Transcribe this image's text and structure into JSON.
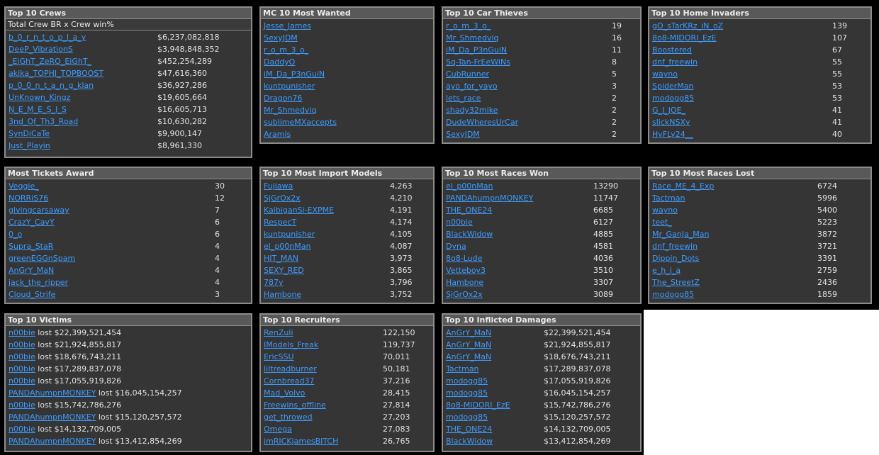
{
  "colors": {
    "background": "#000000",
    "panel_bg": "#353535",
    "panel_border": "#8c8c8c",
    "header_bg": "#595959",
    "link": "#3d9bff",
    "text": "#e2e2e2"
  },
  "top_crews": {
    "title": "Top 10 Crews",
    "subheader": "Total Crew BR x Crew win%",
    "rows": [
      {
        "name": "b_0_r_n_t_o_p_l_a_y",
        "value": "$6,237,082,818"
      },
      {
        "name": "DeeP_VibrationS",
        "value": "$3,948,848,352"
      },
      {
        "name": "_EiGhT_ZeRO_EiGhT_",
        "value": "$452,254,289"
      },
      {
        "name": "akika_TOPHI_TOPBOOST",
        "value": "$47,616,360"
      },
      {
        "name": "p_0_0_n_t_a_n_g_klan",
        "value": "$36,927,286"
      },
      {
        "name": "UnKnown_Kingz",
        "value": "$19,605,664"
      },
      {
        "name": "N_E_M_E_S_I_S",
        "value": "$16,605,713"
      },
      {
        "name": "3nd_Of_Th3_Road",
        "value": "$10,630,282"
      },
      {
        "name": "SynDiCaTe",
        "value": "$9,900,147"
      },
      {
        "name": "Just_Playin",
        "value": "$8,961,330"
      }
    ]
  },
  "mc_most_wanted": {
    "title": "MC 10 Most Wanted",
    "rows": [
      {
        "name": "Jesse_James"
      },
      {
        "name": "SexyJDM"
      },
      {
        "name": "r_o_m_3_o_"
      },
      {
        "name": "DaddyO"
      },
      {
        "name": "iM_Da_P3nGuiN"
      },
      {
        "name": "kuntpunisher"
      },
      {
        "name": "Dragon76"
      },
      {
        "name": "Mr_Shmedviq"
      },
      {
        "name": "sublimeMXaccepts"
      },
      {
        "name": "Aramis"
      }
    ]
  },
  "car_thieves": {
    "title": "Top 10 Car Thieves",
    "rows": [
      {
        "name": "r_o_m_3_o_",
        "value": "19"
      },
      {
        "name": "Mr_Shmedviq",
        "value": "16"
      },
      {
        "name": "iM_Da_P3nGuiN",
        "value": "11"
      },
      {
        "name": "Sq-Tan-FrEeWiNs",
        "value": "8"
      },
      {
        "name": "CubRunner",
        "value": "5"
      },
      {
        "name": "ayo_for_yayo",
        "value": "3"
      },
      {
        "name": "lets_race",
        "value": "2"
      },
      {
        "name": "shady32mike",
        "value": "2"
      },
      {
        "name": "DudeWheresUrCar",
        "value": "2"
      },
      {
        "name": "SexyJDM",
        "value": "2"
      }
    ]
  },
  "home_invaders": {
    "title": "Top 10 Home Invaders",
    "rows": [
      {
        "name": "gO_sTarKRz_iN_oZ",
        "value": "139"
      },
      {
        "name": "8o8-MIDORI_EzE",
        "value": "107"
      },
      {
        "name": "Boostered",
        "value": "67"
      },
      {
        "name": "dnf_freewin",
        "value": "55"
      },
      {
        "name": "wayno",
        "value": "55"
      },
      {
        "name": "SpiderMan",
        "value": "53"
      },
      {
        "name": "modogg85",
        "value": "53"
      },
      {
        "name": "G_I_JOE_",
        "value": "41"
      },
      {
        "name": "slickNSXy",
        "value": "41"
      },
      {
        "name": "HyFLy24__",
        "value": "40"
      }
    ]
  },
  "most_tickets": {
    "title": "Most Tickets Award",
    "rows": [
      {
        "name": "Veggie_",
        "value": "30"
      },
      {
        "name": "NORRiS76",
        "value": "12"
      },
      {
        "name": "givingcarsaway",
        "value": "7"
      },
      {
        "name": "CrazY_CavY",
        "value": "6"
      },
      {
        "name": "0_o",
        "value": "6"
      },
      {
        "name": "Supra_StaR",
        "value": "4"
      },
      {
        "name": "greenEGGnSpam",
        "value": "4"
      },
      {
        "name": "AnGrY_MaN",
        "value": "4"
      },
      {
        "name": "jack_the_ripper",
        "value": "4"
      },
      {
        "name": "Cloud_Strife",
        "value": "3"
      }
    ]
  },
  "import_models": {
    "title": "Top 10 Most Import Models",
    "rows": [
      {
        "name": "Fujiawa",
        "value": "4,263"
      },
      {
        "name": "SjGrOx2x",
        "value": "4,210"
      },
      {
        "name": "KaibiganSi-EXPME",
        "value": "4,191"
      },
      {
        "name": "RespecT",
        "value": "4,174"
      },
      {
        "name": "kuntpunisher",
        "value": "4,105"
      },
      {
        "name": "el_p00nMan",
        "value": "4,087"
      },
      {
        "name": "HIT_MAN",
        "value": "3,973"
      },
      {
        "name": "SEXY_RED",
        "value": "3,865"
      },
      {
        "name": "787y",
        "value": "3,796"
      },
      {
        "name": "Hambone",
        "value": "3,752"
      }
    ]
  },
  "races_won": {
    "title": "Top 10 Most Races Won",
    "rows": [
      {
        "name": "el_p00nMan",
        "value": "13290"
      },
      {
        "name": "PANDAhumpnMONKEY",
        "value": "11747"
      },
      {
        "name": "THE_ONE24",
        "value": "6685"
      },
      {
        "name": "n00bie",
        "value": "6127"
      },
      {
        "name": "BlackWidow",
        "value": "4885"
      },
      {
        "name": "Dyna",
        "value": "4581"
      },
      {
        "name": "8o8-Lude",
        "value": "4036"
      },
      {
        "name": "Vetteboy3",
        "value": "3510"
      },
      {
        "name": "Hambone",
        "value": "3307"
      },
      {
        "name": "SjGrOx2x",
        "value": "3089"
      }
    ]
  },
  "races_lost": {
    "title": "Top 10 Most Races Lost",
    "rows": [
      {
        "name": "Race_ME_4_Exp",
        "value": "6724"
      },
      {
        "name": "Tactman",
        "value": "5996"
      },
      {
        "name": "wayno",
        "value": "5400"
      },
      {
        "name": "teet_",
        "value": "5223"
      },
      {
        "name": "Mr_GanJa_Man",
        "value": "3872"
      },
      {
        "name": "dnf_freewin",
        "value": "3721"
      },
      {
        "name": "Dippin_Dots",
        "value": "3391"
      },
      {
        "name": "e_h_i_a",
        "value": "2759"
      },
      {
        "name": "The_StreetZ",
        "value": "2436"
      },
      {
        "name": "modogg85",
        "value": "1859"
      }
    ]
  },
  "victims": {
    "title": "Top 10 Victims",
    "rows": [
      {
        "name": "n00bie",
        "text": " lost $22,399,521,454"
      },
      {
        "name": "n00bie",
        "text": " lost $21,924,855,817"
      },
      {
        "name": "n00bie",
        "text": " lost $18,676,743,211"
      },
      {
        "name": "n00bie",
        "text": " lost $17,289,837,078"
      },
      {
        "name": "n00bie",
        "text": " lost $17,055,919,826"
      },
      {
        "name": "PANDAhumpnMONKEY",
        "text": " lost $16,045,154,257"
      },
      {
        "name": "n00bie",
        "text": " lost $15,742,786,276"
      },
      {
        "name": "PANDAhumpnMONKEY",
        "text": " lost $15,120,257,572"
      },
      {
        "name": "n00bie",
        "text": " lost $14,132,709,005"
      },
      {
        "name": "PANDAhumpnMONKEY",
        "text": " lost $13,412,854,269"
      }
    ]
  },
  "recruiters": {
    "title": "Top 10 Recruiters",
    "rows": [
      {
        "name": "RenZuli",
        "value": "122,150"
      },
      {
        "name": "IModels_Freak",
        "value": "119,737"
      },
      {
        "name": "EricSSU",
        "value": "70,011"
      },
      {
        "name": "liltreadburner",
        "value": "50,181"
      },
      {
        "name": "Cornbread37",
        "value": "37,216"
      },
      {
        "name": "Mad_Volvo",
        "value": "28,415"
      },
      {
        "name": "Freewins_offline",
        "value": "27,814"
      },
      {
        "name": "get_throwed",
        "value": "27,203"
      },
      {
        "name": "Omega",
        "value": "27,083"
      },
      {
        "name": "imRICKjamesBITCH",
        "value": "26,765"
      }
    ]
  },
  "inflicted_damages": {
    "title": "Top 10 Inflicted Damages",
    "rows": [
      {
        "name": "AnGrY_MaN",
        "value": "$22,399,521,454"
      },
      {
        "name": "AnGrY_MaN",
        "value": "$21,924,855,817"
      },
      {
        "name": "AnGrY_MaN",
        "value": "$18,676,743,211"
      },
      {
        "name": "Tactman",
        "value": "$17,289,837,078"
      },
      {
        "name": "modogg85",
        "value": "$17,055,919,826"
      },
      {
        "name": "modogg85",
        "value": "$16,045,154,257"
      },
      {
        "name": "8o8-MIDORI_EzE",
        "value": "$15,742,786,276"
      },
      {
        "name": "modogg85",
        "value": "$15,120,257,572"
      },
      {
        "name": "THE_ONE24",
        "value": "$14,132,709,005"
      },
      {
        "name": "BlackWidow",
        "value": "$13,412,854,269"
      }
    ]
  }
}
